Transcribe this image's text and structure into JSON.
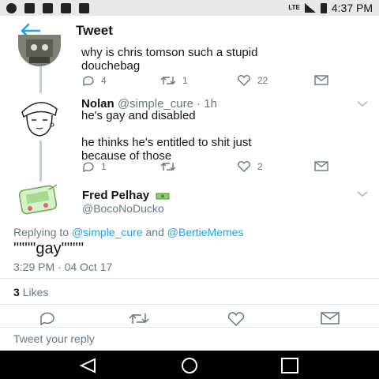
{
  "status_bar": {
    "network": "LTE",
    "time": "4:37 PM"
  },
  "app_bar": {
    "title": "Tweet",
    "back_icon": "arrow-left-icon"
  },
  "thread": [
    {
      "text_line1": "why is chris tomson such a stupid",
      "text_line2": "douchebag",
      "reply_count": "4",
      "retweet_count": "1",
      "like_count": "22"
    },
    {
      "name": "Nolan",
      "handle": "@simple_cure",
      "time": "· 1h",
      "text_line1": "he's gay and disabled",
      "text_line3": "he thinks he's entitled to shit just",
      "text_line4": "because of those",
      "reply_count": "1",
      "retweet_count": "",
      "like_count": "2"
    }
  ],
  "focus_tweet": {
    "name": "Fred Pelhay",
    "name_emoji": "money-icon",
    "handle": "@BocoNoDucko",
    "replying_prefix": "Replying to",
    "replying_user1": "@simple_cure",
    "replying_and": "and",
    "replying_user2": "@BertieMemes",
    "text": "\"\"\"\"gay\"\"\"\"",
    "timestamp": "3:29 PM · 04 Oct 17",
    "likes_count": "3",
    "likes_label": "Likes"
  },
  "reply_box": {
    "placeholder": "Tweet your reply"
  },
  "colors": {
    "accent": "#1da1f2",
    "muted": "#657786",
    "text": "#14171a"
  }
}
